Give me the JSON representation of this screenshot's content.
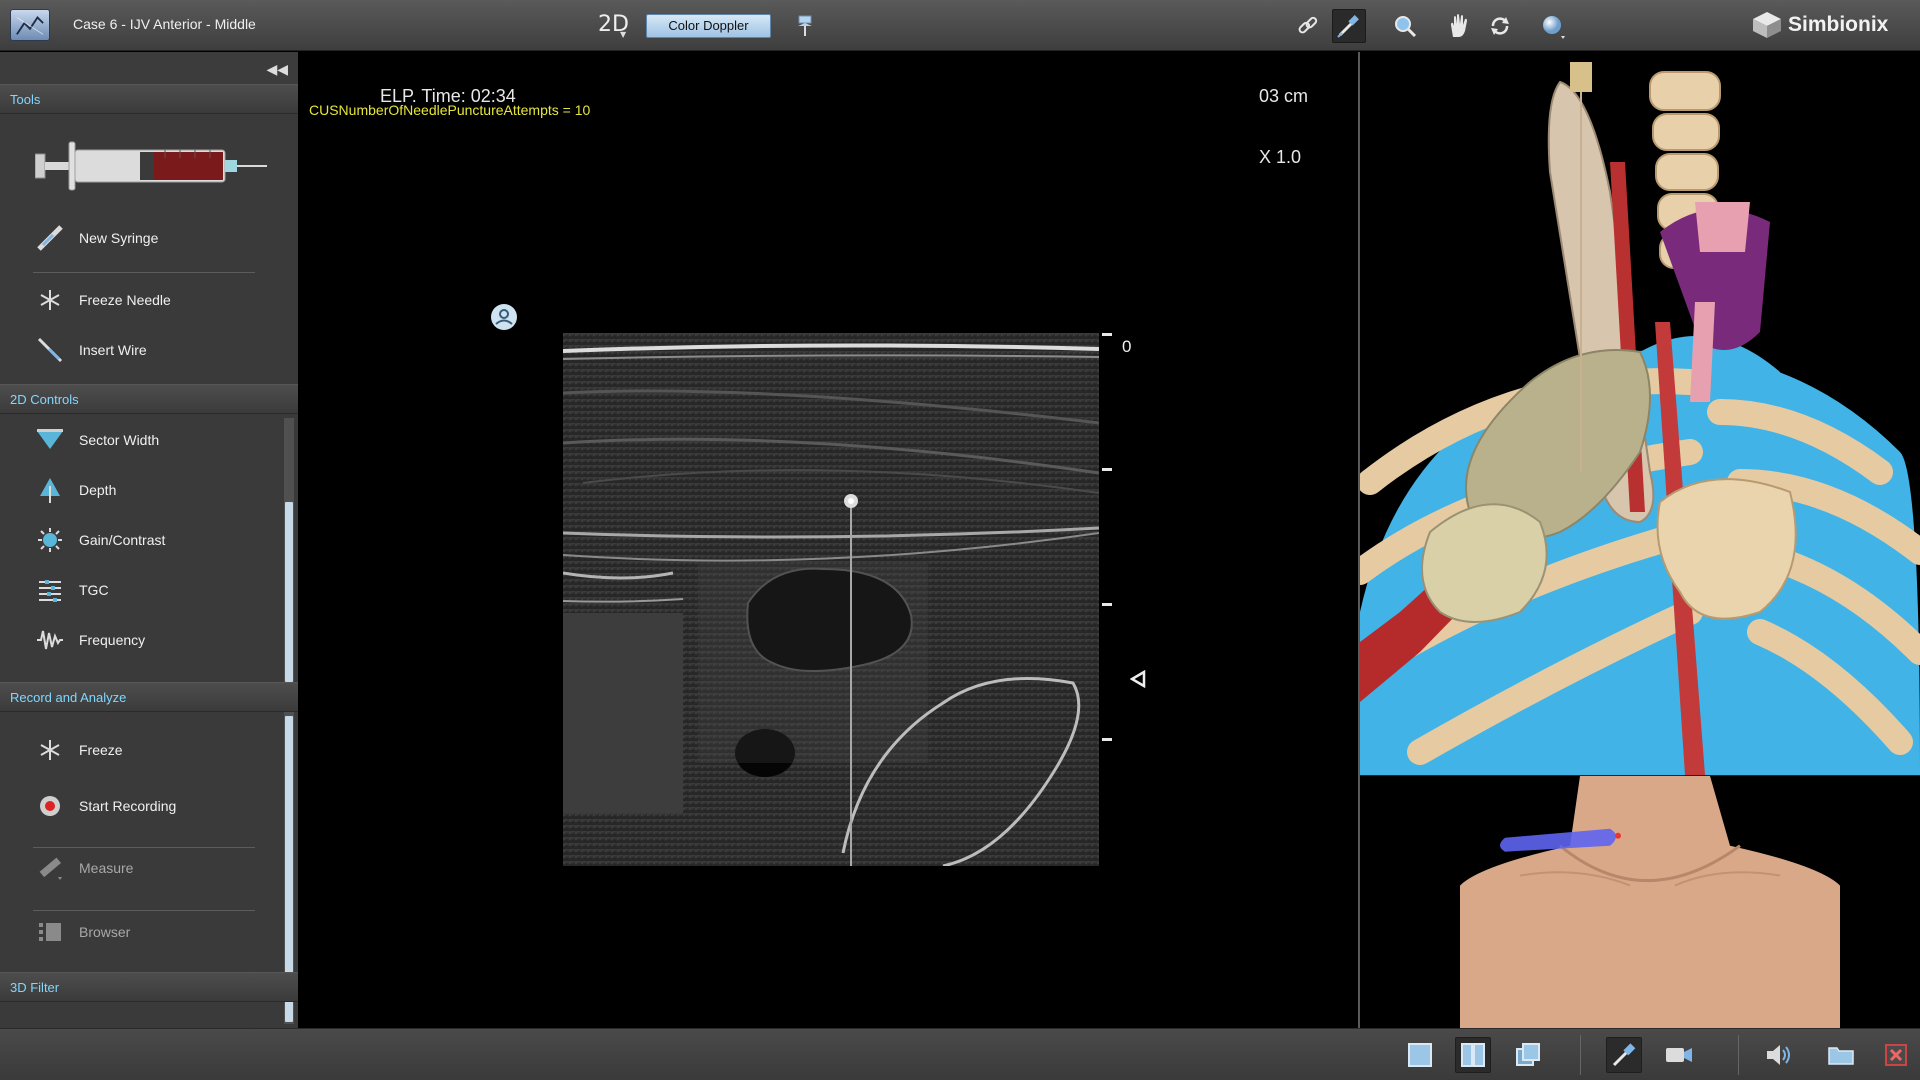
{
  "header": {
    "case_title": "Case 6 - IJV Anterior - Middle",
    "mode_label": "2D",
    "doppler_button": "Color Doppler",
    "brand": "Simbionix",
    "toolbar_icons": [
      "link-icon",
      "needle-view-icon",
      "zoom-icon",
      "pan-hand-icon",
      "rotate-icon",
      "sphere-icon"
    ]
  },
  "sidebar": {
    "collapse_glyph": "◀◀",
    "tools": {
      "title": "Tools",
      "items": [
        {
          "label": "New Syringe",
          "icon": "syringe-icon"
        },
        {
          "label": "Freeze Needle",
          "icon": "snowflake-icon"
        },
        {
          "label": "Insert Wire",
          "icon": "wire-icon"
        }
      ]
    },
    "controls_2d": {
      "title": "2D Controls",
      "items": [
        {
          "label": "Sector Width",
          "icon": "sector-width-icon"
        },
        {
          "label": "Depth",
          "icon": "depth-icon"
        },
        {
          "label": "Gain/Contrast",
          "icon": "gain-contrast-icon"
        },
        {
          "label": "TGC",
          "icon": "tgc-icon"
        },
        {
          "label": "Frequency",
          "icon": "frequency-icon"
        }
      ]
    },
    "record": {
      "title": "Record and Analyze",
      "items": [
        {
          "label": "Freeze",
          "icon": "snowflake-icon"
        },
        {
          "label": "Start Recording",
          "icon": "record-icon"
        },
        {
          "label": "Measure",
          "icon": "measure-icon"
        },
        {
          "label": "Browser",
          "icon": "browser-icon"
        }
      ]
    },
    "filter_3d": {
      "title": "3D Filter"
    }
  },
  "ultrasound": {
    "elp_time": "ELP. Time: 02:34",
    "cus_text": "CUSNumberOfNeedlePunctureAttempts = 10",
    "depth_label": "03 cm",
    "zoom_label": "X 1.0",
    "depth_zero": "0"
  },
  "bottombar": {
    "icons": [
      "single-view-icon",
      "split-view-icon",
      "overlay-view-icon",
      "needle-tool-icon",
      "camera-icon",
      "volume-icon",
      "folder-icon",
      "close-icon"
    ]
  }
}
